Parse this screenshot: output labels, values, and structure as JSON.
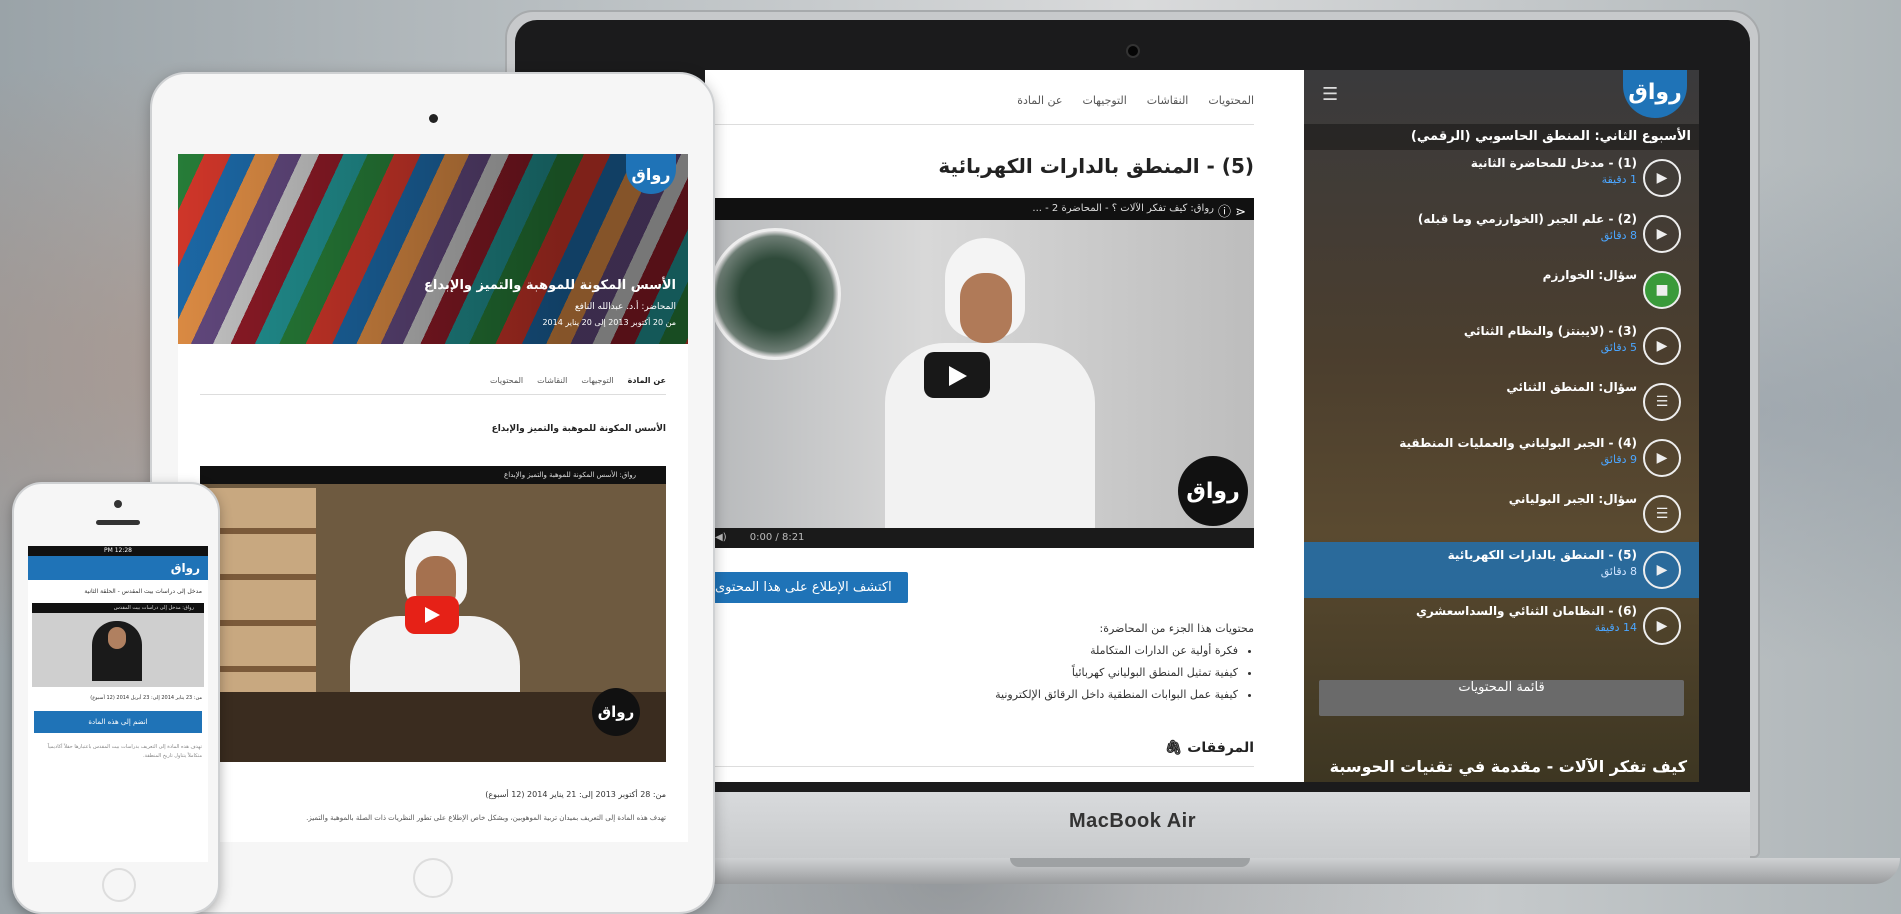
{
  "laptop": {
    "brand": "MacBook Air",
    "sidebar": {
      "logo": "رواق",
      "week_title": "الأسبوع الثاني: المنطق الحاسوبي (الرقمي)",
      "items": [
        {
          "title": "(1) - مدخل للمحاضرة الثانية",
          "duration": "1 دقيقة",
          "icon": "play-icon",
          "active": false
        },
        {
          "title": "(2) - علم الجبر (الخوارزمي وما قبله)",
          "duration": "8 دقائق",
          "icon": "play-icon",
          "active": false
        },
        {
          "title": "سؤال: الخوارزم",
          "duration": "",
          "icon": "check-icon",
          "active": false
        },
        {
          "title": "(3) - (لايبنتز) والنظام الثنائي",
          "duration": "5 دقائق",
          "icon": "play-icon",
          "active": false
        },
        {
          "title": "سؤال: المنطق الثنائي",
          "duration": "",
          "icon": "list-icon",
          "active": false
        },
        {
          "title": "(4) - الجبر البولياني والعمليات المنطقية",
          "duration": "9 دقائق",
          "icon": "play-icon",
          "active": false
        },
        {
          "title": "سؤال: الجبر البولياني",
          "duration": "",
          "icon": "list-icon",
          "active": false
        },
        {
          "title": "(5) - المنطق بالدارات الكهربائية",
          "duration": "8 دقائق",
          "icon": "play-icon",
          "active": true
        },
        {
          "title": "(6) - النظامان الثنائي والسداسعشري",
          "duration": "14 دقيقة",
          "icon": "play-icon",
          "active": false
        }
      ],
      "list_button": "قائمة المحتويات",
      "course_caption": "كيف تفكر الآلات - مقدمة في تقنيات الحوسبة"
    },
    "main": {
      "tabs": [
        "المحتويات",
        "النقاشات",
        "التوجيهات",
        "عن المادة"
      ],
      "lecture_title": "(5) - المنطق بالدارات الكهربائية",
      "video_top": "رواق: كيف تفكر الآلات ؟ - المحاضرة 2 - ...",
      "video_badge": "رواق",
      "video_time": "0:00 / 8:21",
      "report_button": "اكتشف الإطلاع على هذا المحتوى",
      "contents_intro": "محتويات هذا الجزء من المحاضرة:",
      "contents_items": [
        "فكرة أولية عن الدارات المتكاملة",
        "كيفية تمثيل المنطق البولياني كهربائياً",
        "كيفية عمل البوابات المنطقية داخل الرقائق الإلكترونية"
      ],
      "attachments": "المرفقات"
    }
  },
  "tablet": {
    "logo": "رواق",
    "course_title": "الأسس المكونة للموهبة والتميز والإبداع",
    "professor": "المحاضر: أ.د. عبدالله النافع",
    "date_range": "من 20 أكتوبر 2013 إلى 20 يناير 2014",
    "tabs": [
      "المحتويات",
      "النقاشات",
      "التوجيهات",
      "عن المادة"
    ],
    "section_title": "الأسس المكونة للموهبة والتميز والإبداع",
    "video_top": "رواق: الأسس المكونة للموهبة والتميز والإبداع",
    "video_badge": "رواق",
    "dates": "من: 28 أكتوبر 2013 إلى: 21 يناير 2014 (12 أسبوع)",
    "description": "تهدف هذه المادة إلى التعريف بميدان تربية الموهوبين، وبشكل خاص الإطلاع على تطور النظريات ذات الصلة بالموهبة والتميز."
  },
  "phone": {
    "status": "12:28 PM",
    "logo": "رواق",
    "course_title": "مدخل إلى دراسات بيت المقدس - الحلقة الثانية",
    "video_top": "رواق: مدخل إلى دراسات بيت المقدس",
    "dates": "من: 23 يناير 2014 إلى: 23 أبريل 2014 (12 أسبوع)",
    "button": "انضم إلى هذه المادة",
    "description": "تهدف هذه المادة إلى التعريف بدراسات بيت المقدس باعتبارها حقلاً أكاديمياً متكاملاً يتناول تاريخ المنطقة."
  }
}
